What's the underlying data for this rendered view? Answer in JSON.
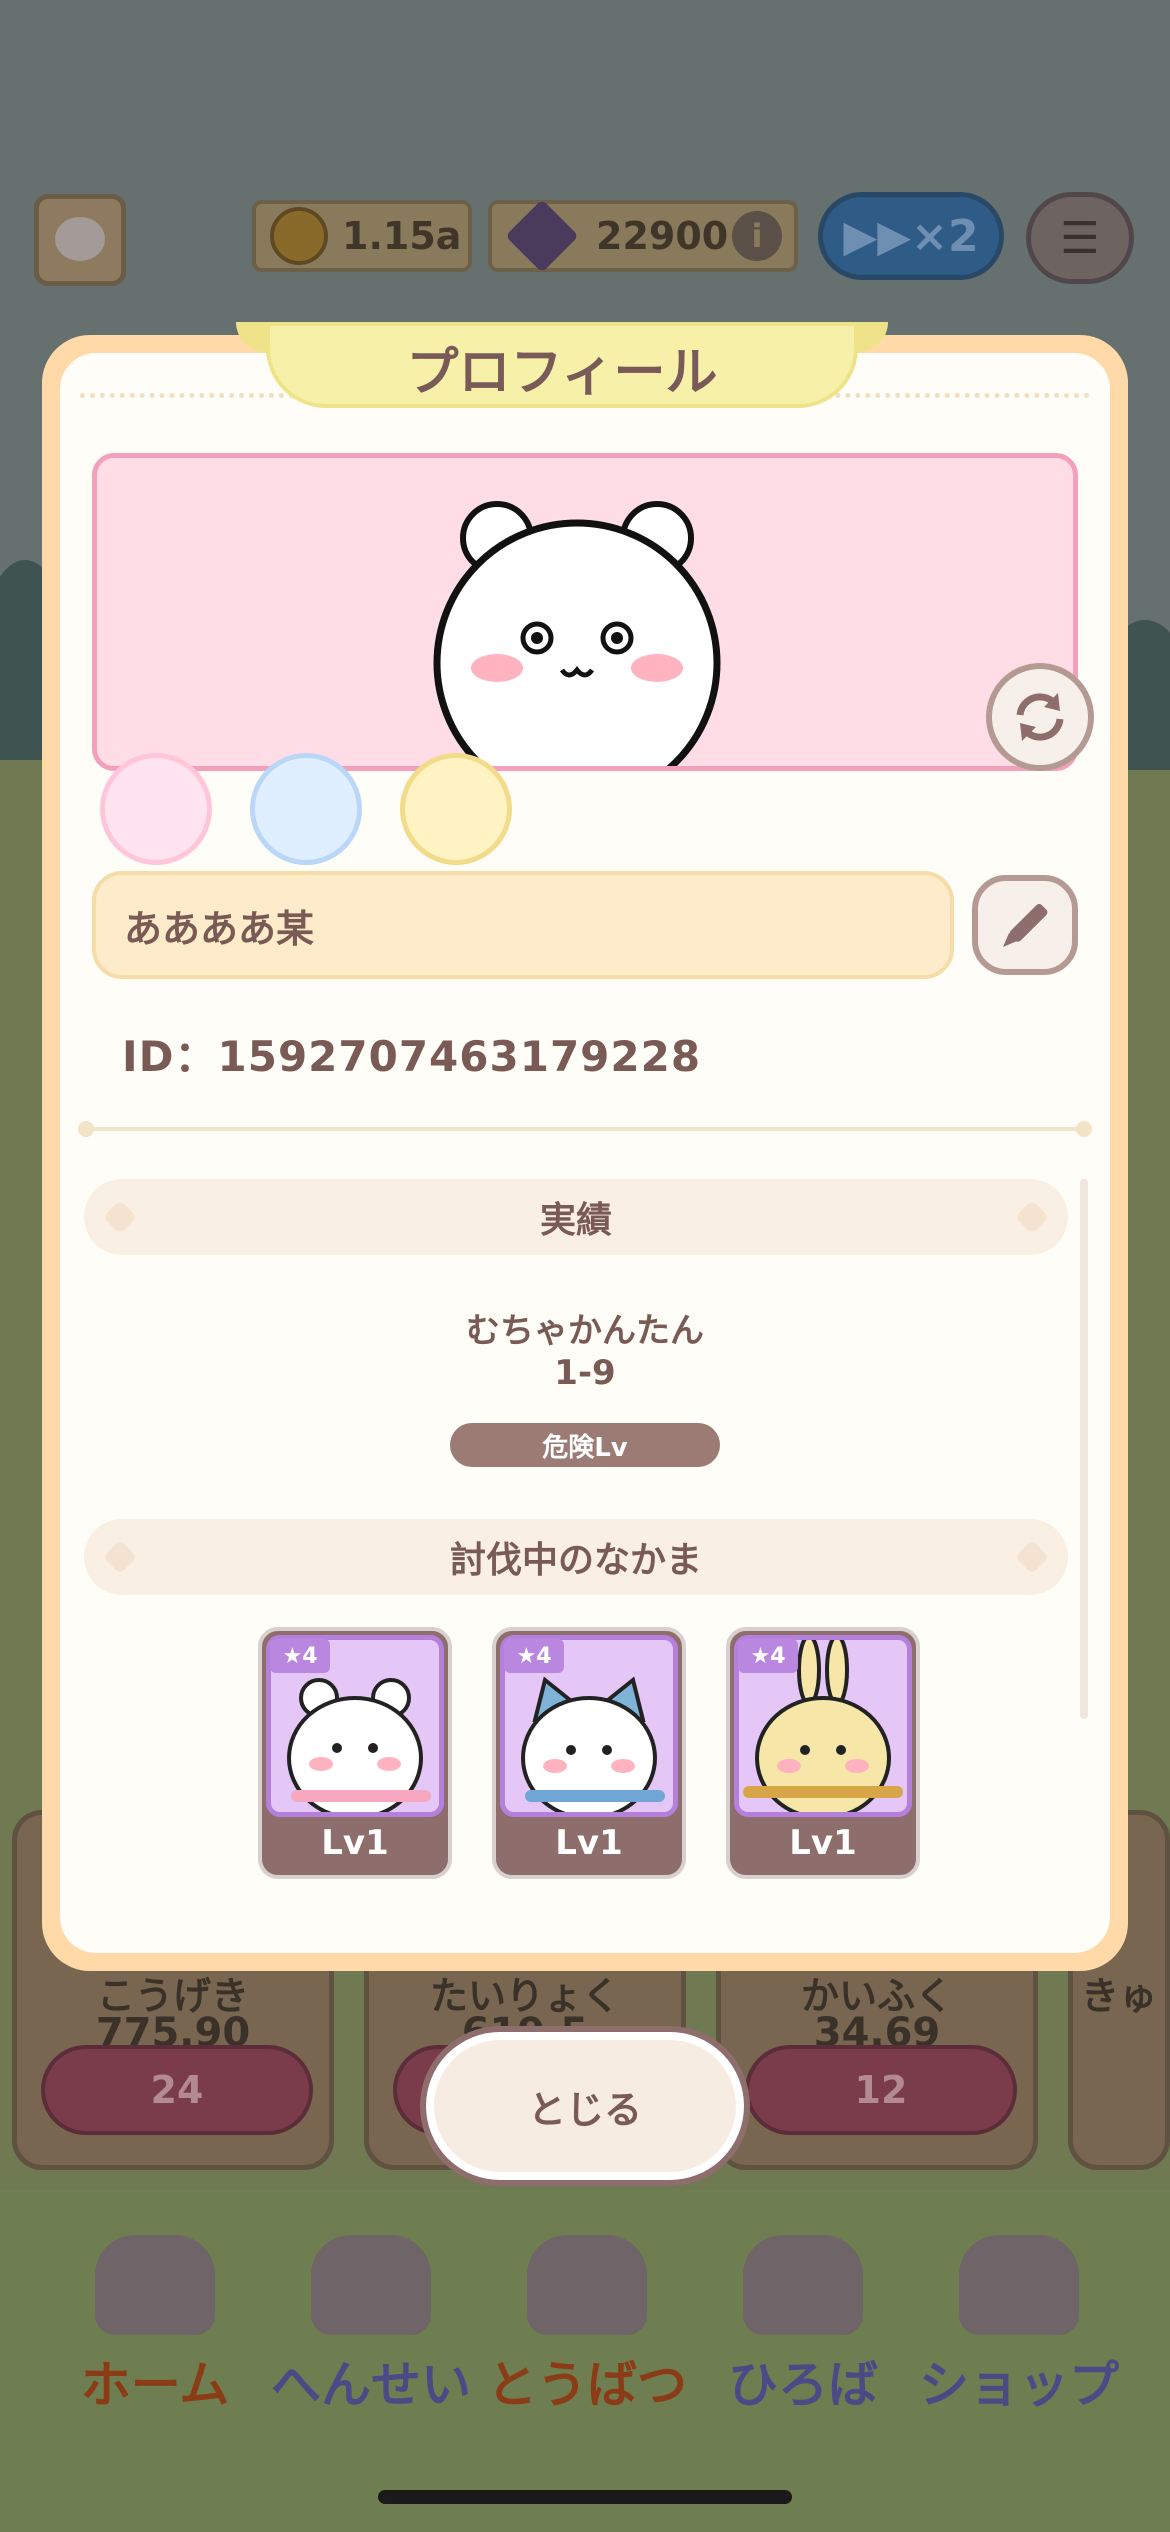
{
  "header": {
    "coins": "1.15a",
    "gems": "22900",
    "info_icon": "i",
    "speed_label": "▶▶×2"
  },
  "background_stats": [
    {
      "name": "こうげき",
      "value": "775.90",
      "cost": "24"
    },
    {
      "name": "たいりょく",
      "value": "619.5",
      "cost": ""
    },
    {
      "name": "かいふく",
      "value": "34.69",
      "cost": "12"
    },
    {
      "name": "きゅ",
      "value": "",
      "cost": ""
    }
  ],
  "nav": {
    "items": [
      {
        "label": "ホーム",
        "color": "#8b3b16"
      },
      {
        "label": "へんせい",
        "color": "#4a4a86"
      },
      {
        "label": "とうばつ",
        "color": "#8b3b16"
      },
      {
        "label": "ひろば",
        "color": "#4a4a86"
      },
      {
        "label": "ショップ",
        "color": "#4a4a86"
      }
    ]
  },
  "modal": {
    "title": "プロフィール",
    "player_name": "ああああ某",
    "player_id": "ID：1592707463179228",
    "achievements_title": "実績",
    "difficulty": "むちゃかんたん",
    "stage": "1-9",
    "danger_badge": "危険Lv",
    "party_title": "討伐中のなかま",
    "party": [
      {
        "stars": "4",
        "level": "Lv1",
        "character": "white-bear"
      },
      {
        "stars": "4",
        "level": "Lv1",
        "character": "blue-cat"
      },
      {
        "stars": "4",
        "level": "Lv1",
        "character": "yellow-rabbit"
      }
    ],
    "close_label": "とじる"
  },
  "colors": {
    "modal_border": "#ffd9a8",
    "pink_box": "#ffdde7",
    "name_field": "#fdebc9",
    "text": "#7a5a55"
  }
}
